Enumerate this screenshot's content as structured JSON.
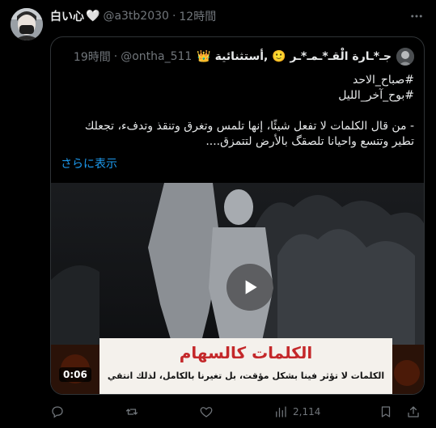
{
  "post": {
    "display_name": "白い心",
    "heart_glyph": "🤍",
    "handle": "@a3tb2030",
    "separator": "·",
    "time": "12時間"
  },
  "quoted": {
    "display_name": "ﺟـ*ـارة الْقـ*ـمـ*ـر 🙂 ,أستثنائية 👑",
    "handle": "@ontha_511",
    "separator": "·",
    "time": "19時間",
    "hashtag_1": "#صباح_الاحد",
    "hashtag_2": "#بوح_آخر_الليل",
    "body": "- من قال الكلمات لا تفعل شيئًا، إنها تلمس وتغرق وتنقذ وتدفء، تجعلك تطير وتتسع  واحيانا تلصقگ بالأرض لتتمزق....",
    "show_more": "さらに表示"
  },
  "video": {
    "banner_title": "الكلمات كالسهام",
    "banner_subtitle": "الكلمات لا تؤثر فينا بشكل مؤقت، بل تغيرنا بالكامل، لذلك انتقي",
    "duration": "0:06"
  },
  "actions": {
    "views_count": "2,114"
  },
  "colors": {
    "background": "#000000",
    "text": "#e7e9ea",
    "secondary": "#71767b",
    "link": "#1d9bf0",
    "border": "#2f3336",
    "banner_title": "#c4282a"
  },
  "icons": [
    "more-icon",
    "reply-icon",
    "repost-icon",
    "like-icon",
    "views-icon",
    "bookmark-icon",
    "share-icon",
    "play-icon"
  ]
}
